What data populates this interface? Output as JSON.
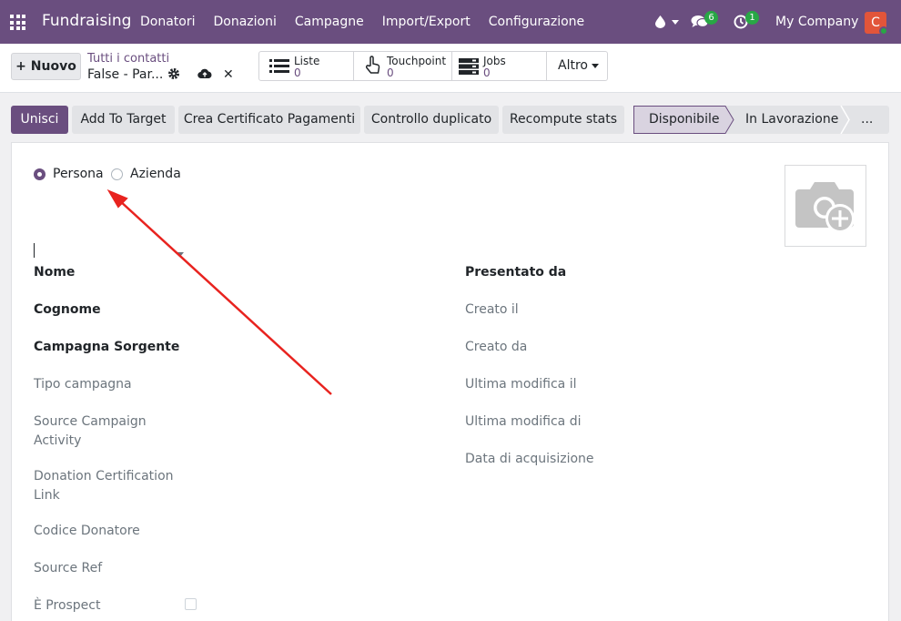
{
  "navbar": {
    "app_name": "Fundraising",
    "menu": [
      "Donatori",
      "Donazioni",
      "Campagne",
      "Import/Export",
      "Configurazione"
    ],
    "chat_count": "6",
    "activity_count": "1",
    "company": "My Company",
    "avatar_letter": "C",
    "accent_color": "#6a4e7f"
  },
  "control": {
    "new_label": "Nuovo",
    "breadcrumb_parent": "Tutti i contatti",
    "breadcrumb_current": "False - Par...",
    "smart_buttons": [
      {
        "label": "Liste",
        "value": "0",
        "icon": "list-icon"
      },
      {
        "label": "Touchpoint",
        "value": "0",
        "icon": "hand-pointer-icon"
      },
      {
        "label": "Jobs",
        "value": "0",
        "icon": "server-icon"
      }
    ],
    "more_label": "Altro"
  },
  "actions": {
    "buttons": [
      "Unisci",
      "Add To Target",
      "Crea Certificato Pagamenti",
      "Controllo duplicato",
      "Recompute stats"
    ],
    "stages": [
      "Disponibile",
      "In Lavorazione",
      "..."
    ]
  },
  "form": {
    "type_options": [
      "Persona",
      "Azienda"
    ],
    "left_fields": [
      {
        "label": "Nome",
        "bold": true
      },
      {
        "label": "Cognome",
        "bold": true
      },
      {
        "label": "Campagna Sorgente",
        "bold": true
      },
      {
        "label": "Tipo campagna",
        "bold": false
      },
      {
        "label": "Source Campaign\nActivity",
        "bold": false
      },
      {
        "label": "Donation Certification\nLink",
        "bold": false
      },
      {
        "label": "Codice Donatore",
        "bold": false
      },
      {
        "label": "Source Ref",
        "bold": false
      },
      {
        "label": "È Prospect",
        "bold": false
      }
    ],
    "right_fields": [
      {
        "label": "Presentato da",
        "bold": true
      },
      {
        "label": "Creato il",
        "bold": false
      },
      {
        "label": "Creato da",
        "bold": false
      },
      {
        "label": "Ultima modifica il",
        "bold": false
      },
      {
        "label": "Ultima modifica di",
        "bold": false
      },
      {
        "label": "Data di acquisizione",
        "bold": false
      }
    ]
  },
  "annotation": {
    "arrow_color": "#e8231f"
  }
}
